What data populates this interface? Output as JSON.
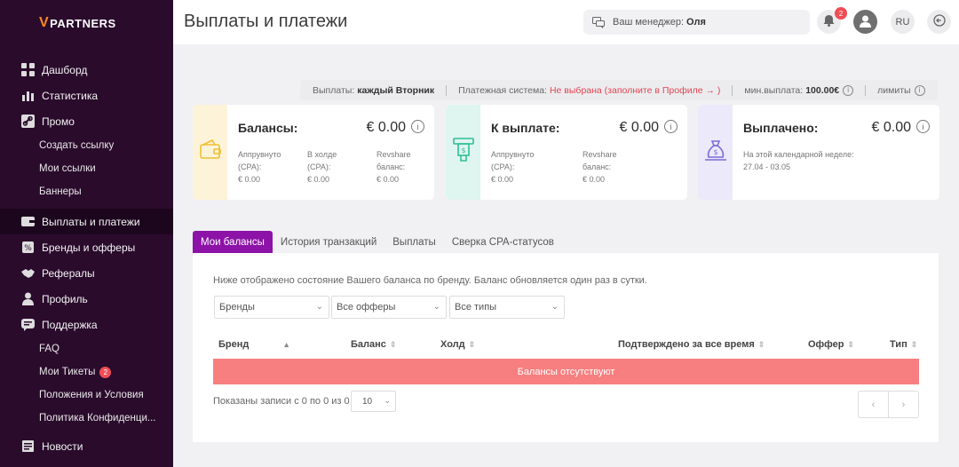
{
  "brand": {
    "logo_mark": "V",
    "logo_text": "PARTNERS"
  },
  "sidebar": {
    "items": [
      {
        "label": "Дашборд"
      },
      {
        "label": "Статистика"
      },
      {
        "label": "Промо"
      },
      {
        "label": "Создать ссылку"
      },
      {
        "label": "Мои ссылки"
      },
      {
        "label": "Баннеры"
      },
      {
        "label": "Выплаты и платежи"
      },
      {
        "label": "Бренды и офферы"
      },
      {
        "label": "Рефералы"
      },
      {
        "label": "Профиль"
      },
      {
        "label": "Поддержка"
      },
      {
        "label": "FAQ"
      },
      {
        "label": "Мои Тикеты",
        "badge": "2"
      },
      {
        "label": "Положения и Условия"
      },
      {
        "label": "Политика Конфиденци..."
      },
      {
        "label": "Новости"
      }
    ]
  },
  "header": {
    "title": "Выплаты и платежи",
    "manager_label": "Ваш менеджер:",
    "manager_name": "Оля",
    "notifications_count": "2",
    "language": "RU"
  },
  "infobar": {
    "payouts_label": "Выплаты:",
    "payouts_value": "каждый Вторник",
    "system_label": "Платежная система:",
    "system_value": "Не выбрана (заполните в Профиле → )",
    "min_label": "мин.выплата:",
    "min_value": "100.00€",
    "limits_label": "лимиты",
    "info_glyph": "i"
  },
  "cards": [
    {
      "title": "Балансы:",
      "value": "€ 0.00",
      "color": "#fdf3d8",
      "icon_color": "#f0c033",
      "cols": [
        {
          "label1": "Аппрувнуто",
          "label2": "(CPA):",
          "value": "€ 0.00"
        },
        {
          "label1": "В холде",
          "label2": "(CPA):",
          "value": "€ 0.00"
        },
        {
          "label1": "Revshare",
          "label2": "баланс:",
          "value": "€ 0.00"
        }
      ]
    },
    {
      "title": "К выплате:",
      "value": "€ 0.00",
      "color": "#dff5ef",
      "icon_color": "#2fbf94",
      "cols": [
        {
          "label1": "Аппрувнуто",
          "label2": "(CPA):",
          "value": "€ 0.00"
        },
        {
          "label1": "Revshare",
          "label2": "баланс:",
          "value": "€ 0.00"
        }
      ]
    },
    {
      "title": "Выплачено:",
      "value": "€ 0.00",
      "color": "#ece9fb",
      "icon_color": "#7d6bd8",
      "note": "На этой календарной неделе:",
      "range": "27.04 - 03.05"
    }
  ],
  "tabs": [
    {
      "label": "Мои балансы",
      "active": true
    },
    {
      "label": "История транзакций"
    },
    {
      "label": "Выплаты"
    },
    {
      "label": "Сверка CPA-статусов"
    }
  ],
  "panel": {
    "description": "Ниже отображено состояние Вашего баланса по бренду. Баланс обновляется один раз в сутки.",
    "filters": [
      "Бренды",
      "Все офферы",
      "Все типы"
    ],
    "columns": [
      "Бренд",
      "Баланс",
      "Холд",
      "Подтверждено за все время",
      "Оффер",
      "Тип"
    ],
    "empty_text": "Балансы отсутствуют",
    "showing_text": "Показаны записи с 0 по 0 из 0",
    "per_page": "10"
  },
  "colors": {
    "accent": "#8d12a8",
    "sidebar": "#2a0b2c",
    "empty_row": "#f77f7f",
    "badge": "#ef4d56"
  }
}
